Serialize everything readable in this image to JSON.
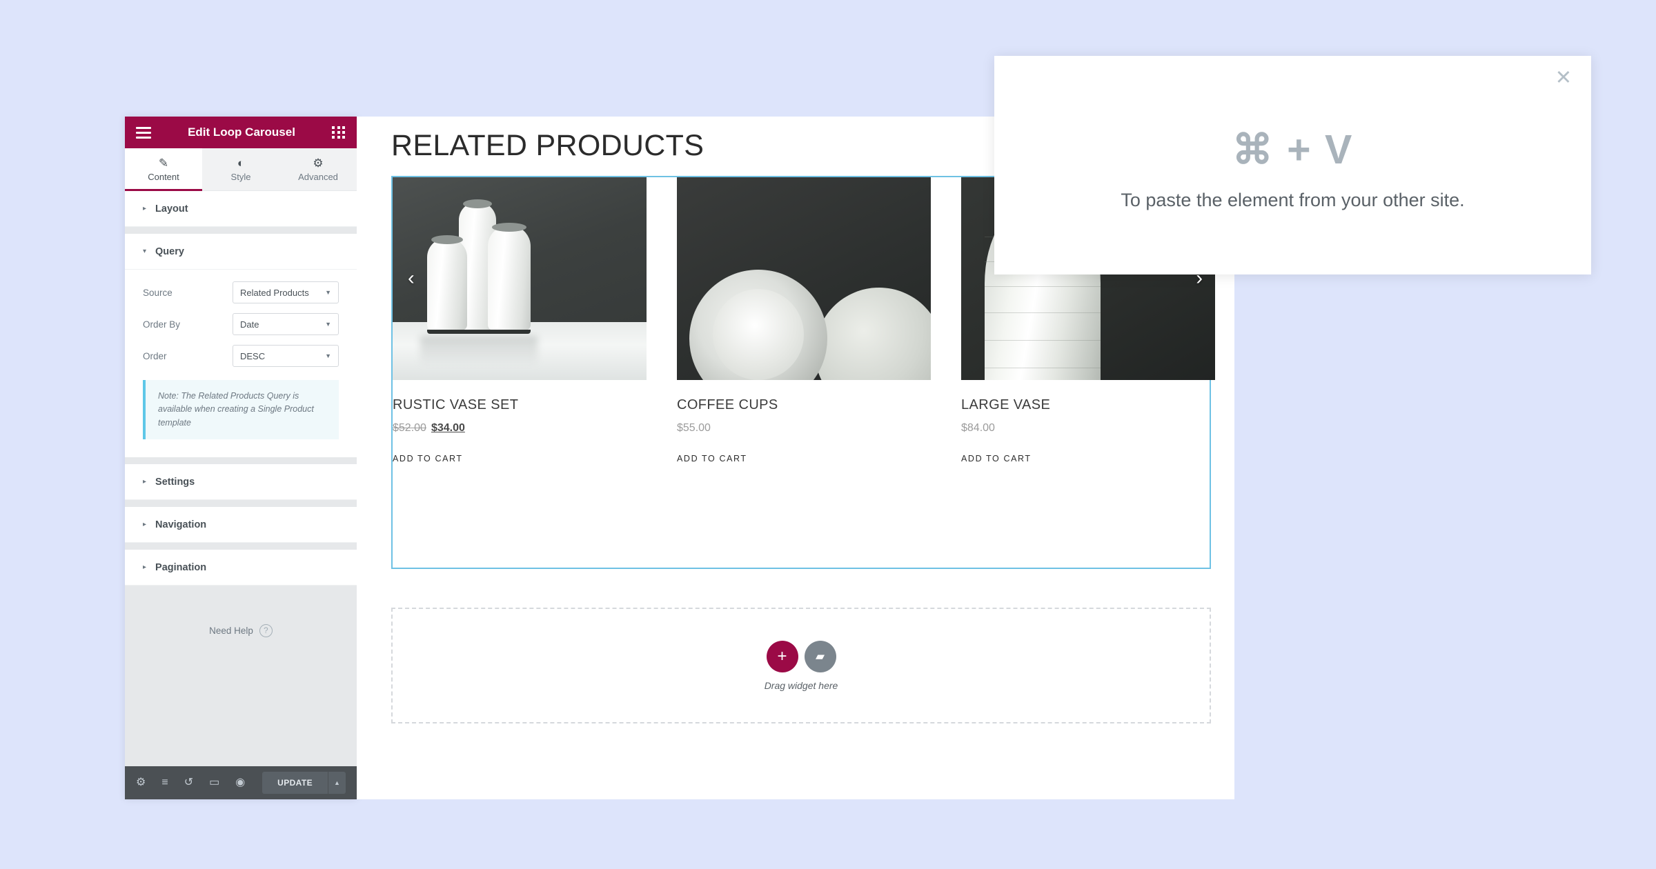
{
  "colors": {
    "brand": "#9b0a46",
    "page_background": "#dde4fb",
    "selection_outline": "#6ec1e4",
    "panel_footer": "#4b5054",
    "note_accent": "#5ec7e8"
  },
  "panel": {
    "title": "Edit Loop Carousel",
    "menu_icon": "hamburger-icon",
    "grid_icon": "grid-icon",
    "tabs": [
      {
        "label": "Content",
        "icon": "pencil-icon",
        "glyph": "✎",
        "active": true
      },
      {
        "label": "Style",
        "icon": "contrast-icon",
        "glyph": "◐",
        "active": false
      },
      {
        "label": "Advanced",
        "icon": "gear-icon",
        "glyph": "⚙",
        "active": false
      }
    ],
    "sections": [
      {
        "label": "Layout",
        "expanded": false,
        "caret": "▸"
      },
      {
        "label": "Query",
        "expanded": true,
        "caret": "▾"
      },
      {
        "label": "Settings",
        "expanded": false,
        "caret": "▸"
      },
      {
        "label": "Navigation",
        "expanded": false,
        "caret": "▸"
      },
      {
        "label": "Pagination",
        "expanded": false,
        "caret": "▸"
      }
    ],
    "query": {
      "source": {
        "label": "Source",
        "value": "Related Products"
      },
      "order_by": {
        "label": "Order By",
        "value": "Date"
      },
      "order": {
        "label": "Order",
        "value": "DESC"
      },
      "note": "Note: The Related Products Query is available when creating a Single Product template"
    },
    "need_help": {
      "label": "Need Help",
      "icon": "question-mark-icon",
      "glyph": "?"
    },
    "footer": {
      "icons": [
        {
          "name": "settings-gear-icon",
          "glyph": "⚙"
        },
        {
          "name": "navigator-layers-icon",
          "glyph": "≡"
        },
        {
          "name": "history-icon",
          "glyph": "↺"
        },
        {
          "name": "responsive-mode-icon",
          "glyph": "▭"
        },
        {
          "name": "preview-eye-icon",
          "glyph": "◉"
        }
      ],
      "update_label": "UPDATE",
      "update_caret": "▲"
    },
    "collapse_caret": "‹"
  },
  "canvas": {
    "heading": "RELATED PRODUCTS",
    "carousel": {
      "prev_arrow": "‹",
      "next_arrow": "›",
      "products": [
        {
          "title": "RUSTIC VASE SET",
          "price_old": "$52.00",
          "price_new": "$34.00",
          "on_sale": true,
          "add_to_cart": "ADD TO CART",
          "image_alt": "three-white-ceramic-vases"
        },
        {
          "title": "COFFEE CUPS",
          "price": "$55.00",
          "on_sale": false,
          "add_to_cart": "ADD TO CART",
          "image_alt": "white-ceramic-coffee-cups"
        },
        {
          "title": "LARGE VASE",
          "price": "$84.00",
          "on_sale": false,
          "add_to_cart": "ADD TO CART",
          "image_alt": "large-white-ceramic-vase"
        }
      ]
    },
    "dropzone": {
      "add_glyph": "+",
      "folder_glyph": "▰",
      "label": "Drag widget here"
    }
  },
  "modal": {
    "close_glyph": "✕",
    "shortcut": "⌘ + V",
    "message": "To paste the element from your other site."
  }
}
